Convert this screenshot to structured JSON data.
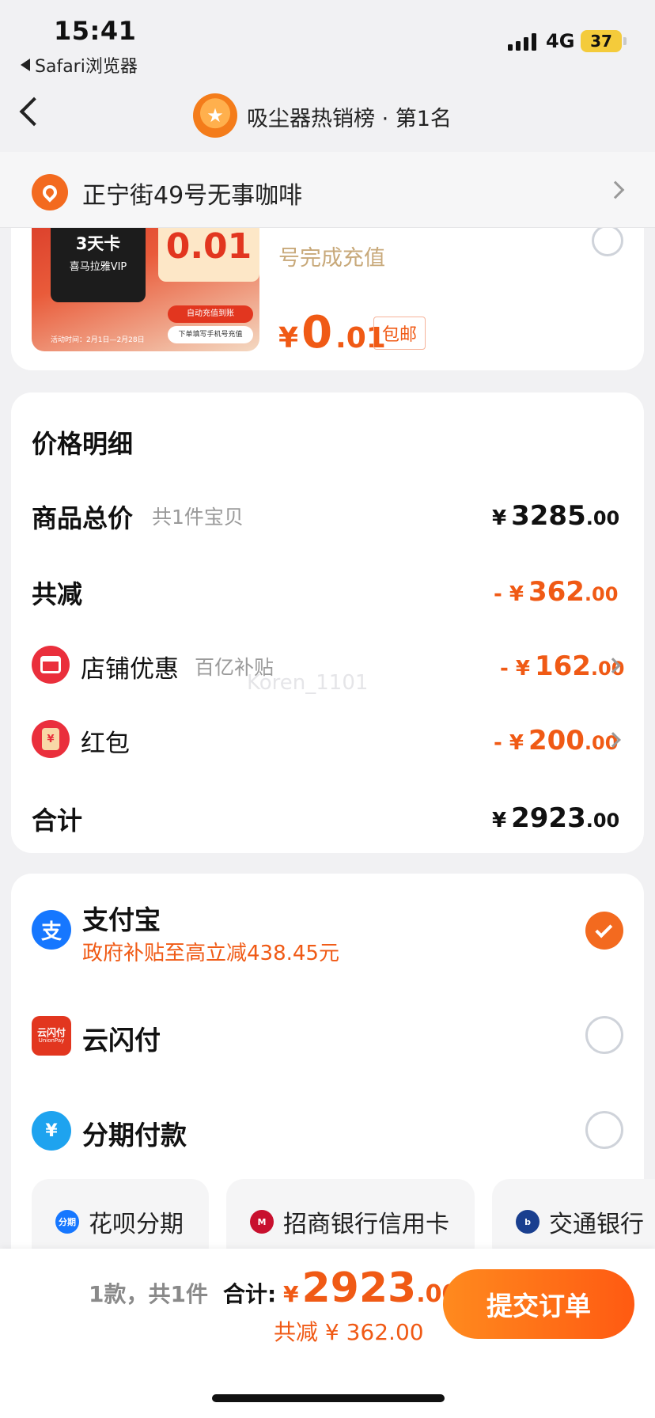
{
  "status": {
    "time": "15:41",
    "back_app": "Safari浏览器",
    "network": "4G",
    "battery": "37"
  },
  "nav": {
    "title": "吸尘器热销榜 · 第1名"
  },
  "address": {
    "text": "正宁街49号无事咖啡"
  },
  "product": {
    "image": {
      "badge_big": "3天卡",
      "badge_small": "喜马拉雅VIP",
      "price": "0.01",
      "tag1": "自动充值到账",
      "tag2": "下单填写手机号充值",
      "footer": "活动时间：2月1日—2月28日"
    },
    "sub_text": "号完成充值",
    "price": {
      "currency": "¥",
      "integer": "0",
      "decimal": ".01"
    },
    "shipping_badge": "包邮"
  },
  "price_detail": {
    "title": "价格明细",
    "rows": [
      {
        "label": "商品总价",
        "sub": "共1件宝贝",
        "currency": "¥",
        "integer": "3285",
        "decimal": ".00"
      },
      {
        "label": "共减",
        "currency": "- ¥",
        "integer": "362",
        "decimal": ".00"
      },
      {
        "label": "店铺优惠",
        "sub": "百亿补贴",
        "currency": "- ¥",
        "integer": "162",
        "decimal": ".00"
      },
      {
        "label": "红包",
        "currency": "- ¥",
        "integer": "200",
        "decimal": ".00"
      },
      {
        "label": "合计",
        "currency": "¥",
        "integer": "2923",
        "decimal": ".00"
      }
    ],
    "hongbao_icon_text": "¥",
    "watermark": "Koren_1101"
  },
  "payment": {
    "methods": [
      {
        "label": "支付宝",
        "sub": "政府补贴至高立减438.45元",
        "icon_text": "支",
        "selected": true
      },
      {
        "label": "云闪付",
        "icon_text": "云闪付",
        "icon_sub": "UnionPay",
        "selected": false
      },
      {
        "label": "分期付款",
        "icon_text": "¥",
        "selected": false
      }
    ],
    "installments": [
      {
        "label": "花呗分期",
        "icon_text": "分期"
      },
      {
        "label": "招商银行信用卡",
        "icon_text": "M"
      },
      {
        "label": "交通银行",
        "icon_text": "b"
      }
    ]
  },
  "summary": {
    "count": "1款，共1件",
    "total_label": "合计:",
    "currency": "¥",
    "integer": "2923",
    "decimal": ".00",
    "discount": "共减 ¥ 362.00",
    "submit": "提交订单"
  },
  "colors": {
    "accent": "#f05a15",
    "alipay": "#1677ff",
    "red": "#ea2f3c"
  }
}
